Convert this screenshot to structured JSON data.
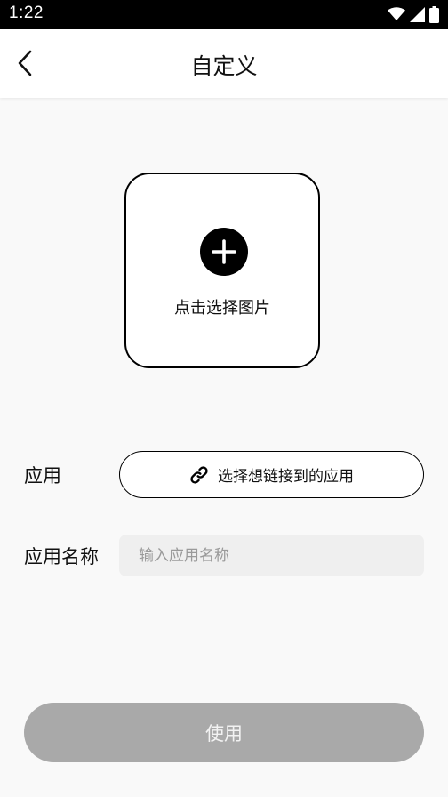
{
  "status_bar": {
    "time": "1:22",
    "icons": [
      "wifi-icon",
      "signal-icon",
      "battery-icon"
    ]
  },
  "app_bar": {
    "back_icon": "back-arrow-icon",
    "title": "自定义"
  },
  "image_picker": {
    "icon": "plus-circle-icon",
    "label": "点击选择图片"
  },
  "app_row": {
    "label": "应用",
    "button_icon": "link-icon",
    "button_label": "选择想链接到的应用"
  },
  "name_row": {
    "label": "应用名称",
    "placeholder": "输入应用名称",
    "value": ""
  },
  "footer": {
    "use_label": "使用"
  },
  "colors": {
    "background": "#f9f9f9",
    "app_bar": "#ffffff",
    "status_bar": "#000000",
    "use_button_disabled": "#a9a9a9",
    "input_background": "#efefef"
  }
}
